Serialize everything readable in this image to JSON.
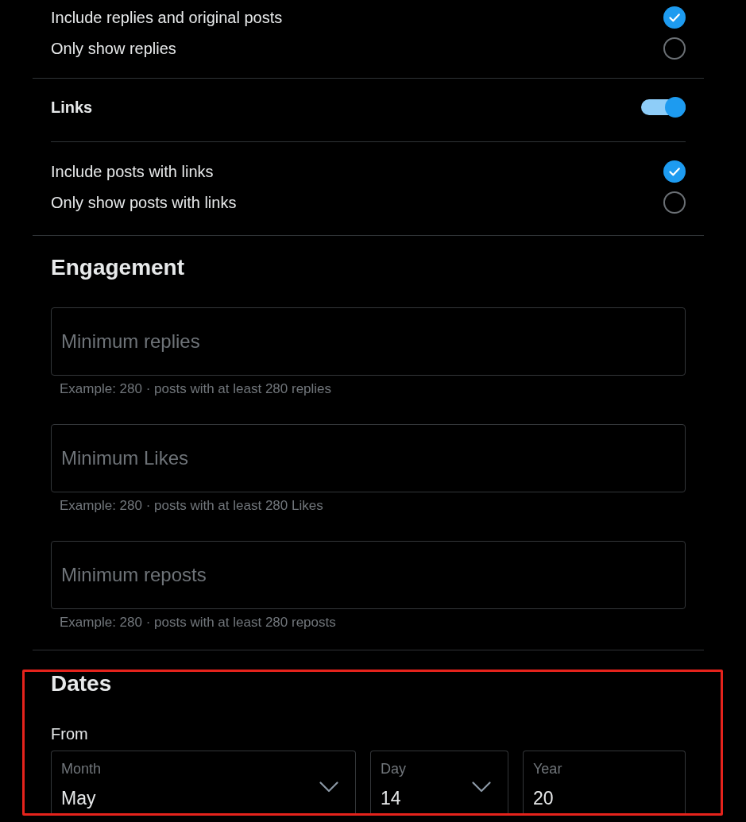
{
  "reply_options": [
    {
      "label": "Include replies and original posts",
      "selected": true
    },
    {
      "label": "Only show replies",
      "selected": false
    }
  ],
  "links": {
    "label": "Links",
    "on": true,
    "options": [
      {
        "label": "Include posts with links",
        "selected": true
      },
      {
        "label": "Only show posts with links",
        "selected": false
      }
    ]
  },
  "engagement": {
    "title": "Engagement",
    "fields": [
      {
        "placeholder": "Minimum replies",
        "hint": "Example: 280 · posts with at least 280 replies"
      },
      {
        "placeholder": "Minimum Likes",
        "hint": "Example: 280 · posts with at least 280 Likes"
      },
      {
        "placeholder": "Minimum reposts",
        "hint": "Example: 280 · posts with at least 280 reposts"
      }
    ]
  },
  "dates": {
    "title": "Dates",
    "highlighted": true,
    "from": {
      "label": "From",
      "selects": [
        {
          "label": "Month",
          "value": "May",
          "chevron": true
        },
        {
          "label": "Day",
          "value": "14",
          "chevron": true
        },
        {
          "label": "Year",
          "value": "20",
          "chevron": false
        }
      ]
    }
  }
}
